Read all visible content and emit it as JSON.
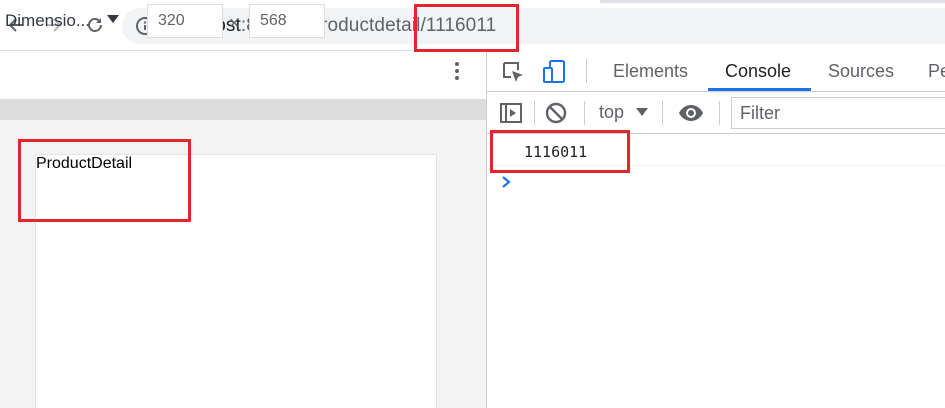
{
  "browser": {
    "url_host": "localhost",
    "url_path": ":8080/#/productdetail/1116011"
  },
  "device_toolbar": {
    "dimensions_label": "Dimensio...",
    "width_value": "320",
    "times_symbol": "×",
    "height_value": "568"
  },
  "page": {
    "content_text": "ProductDetail"
  },
  "devtools": {
    "tabs": [
      {
        "label": "Elements",
        "active": false
      },
      {
        "label": "Console",
        "active": true
      },
      {
        "label": "Sources",
        "active": false
      },
      {
        "label": "Pe",
        "active": false
      }
    ],
    "console_context": "top",
    "filter_placeholder": "Filter",
    "log_output": "1116011",
    "accent_color": "#1a73e8"
  },
  "annotation_color": "#e3262b"
}
